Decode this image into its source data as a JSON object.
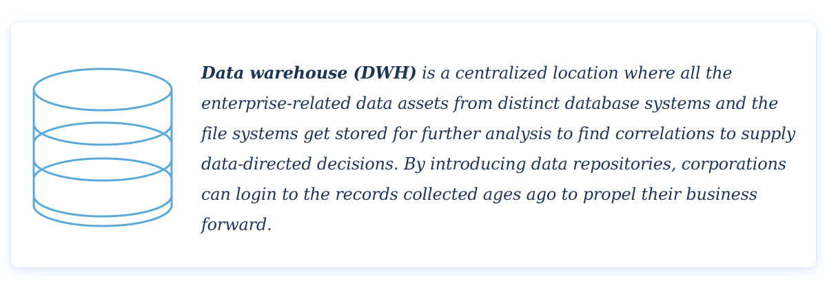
{
  "definition": {
    "term": "Data warehouse (DWH)",
    "body": " is a centralized location where all the enterprise-related data assets from distinct database systems and the file systems get stored for further analysis to find correlations to supply data-directed decisions. By introducing data repositories, corporations can login to the records collected ages ago to propel their business forward."
  },
  "icon": {
    "name": "database-icon",
    "stroke_color": "#5aa9d8"
  },
  "colors": {
    "text": "#1d3557",
    "card_shadow": "#78aadc"
  }
}
